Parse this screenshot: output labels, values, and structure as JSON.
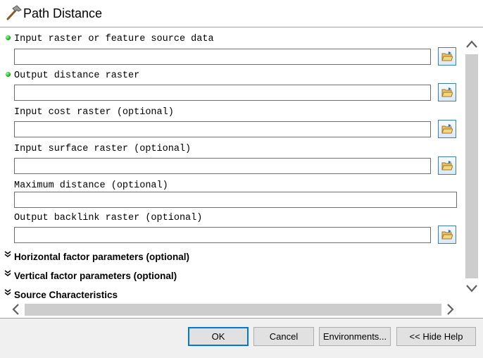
{
  "window": {
    "title": "Path Distance",
    "icon": "hammer-icon"
  },
  "parameters": [
    {
      "label": "Input raster or feature source data",
      "value": "",
      "required": true,
      "browse": true
    },
    {
      "label": "Output distance raster",
      "value": "",
      "required": true,
      "browse": true
    },
    {
      "label": "Input cost raster (optional)",
      "value": "",
      "required": false,
      "browse": true
    },
    {
      "label": "Input surface raster (optional)",
      "value": "",
      "required": false,
      "browse": true
    },
    {
      "label": "Maximum distance (optional)",
      "value": "",
      "required": false,
      "browse": false
    },
    {
      "label": "Output backlink raster (optional)",
      "value": "",
      "required": false,
      "browse": true
    }
  ],
  "sections": [
    {
      "label": "Horizontal factor parameters (optional)",
      "expanded": false
    },
    {
      "label": "Vertical factor parameters (optional)",
      "expanded": false
    },
    {
      "label": "Source Characteristics",
      "expanded": false
    }
  ],
  "buttons": {
    "ok": "OK",
    "cancel": "Cancel",
    "environments": "Environments...",
    "hide_help": "<< Hide Help"
  },
  "colors": {
    "required_indicator": "#13b413",
    "default_button_border": "#0078d7",
    "browse_button_border": "#3c7fb1"
  }
}
